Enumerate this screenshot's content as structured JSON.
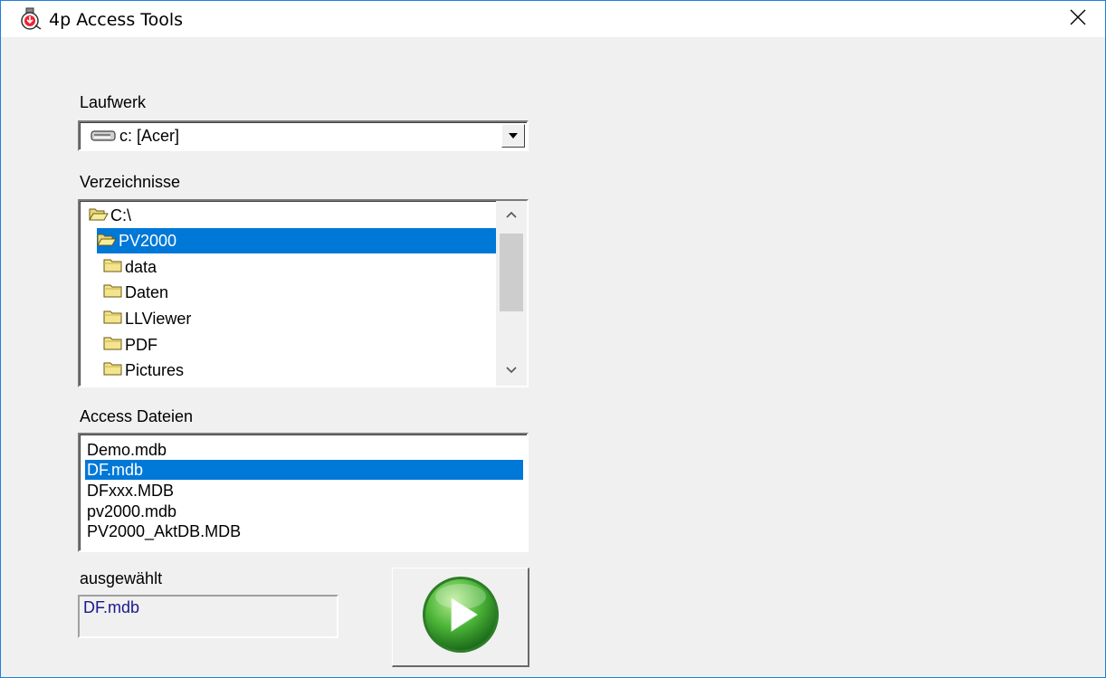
{
  "window": {
    "title": "4p Access Tools",
    "close_glyph": "✕"
  },
  "drive": {
    "label": "Laufwerk",
    "value": "c: [Acer]",
    "icon": "drive-icon"
  },
  "directories": {
    "label": "Verzeichnisse",
    "items": [
      {
        "name": "C:\\",
        "icon": "open-folder-icon",
        "selected": false
      },
      {
        "name": "PV2000",
        "icon": "open-folder-icon",
        "selected": true
      },
      {
        "name": "data",
        "icon": "folder-icon",
        "selected": false
      },
      {
        "name": "Daten",
        "icon": "folder-icon",
        "selected": false
      },
      {
        "name": "LLViewer",
        "icon": "folder-icon",
        "selected": false
      },
      {
        "name": "PDF",
        "icon": "folder-icon",
        "selected": false
      },
      {
        "name": "Pictures",
        "icon": "folder-icon",
        "selected": false
      }
    ]
  },
  "files": {
    "label": "Access Dateien",
    "items": [
      "Demo.mdb",
      "DF.mdb",
      "DFxxx.MDB",
      "pv2000.mdb",
      "PV2000_AktDB.MDB"
    ],
    "selected_index": 1
  },
  "selection": {
    "label": "ausgewählt",
    "value": "DF.mdb"
  },
  "run_button": {
    "icon": "play-icon"
  },
  "colors": {
    "selection": "#0078d7",
    "window_bg": "#f0f0f0",
    "border_accent": "#1e7fd8",
    "play_green": "#3aa32f",
    "selected_text": "#1a1a8c"
  }
}
